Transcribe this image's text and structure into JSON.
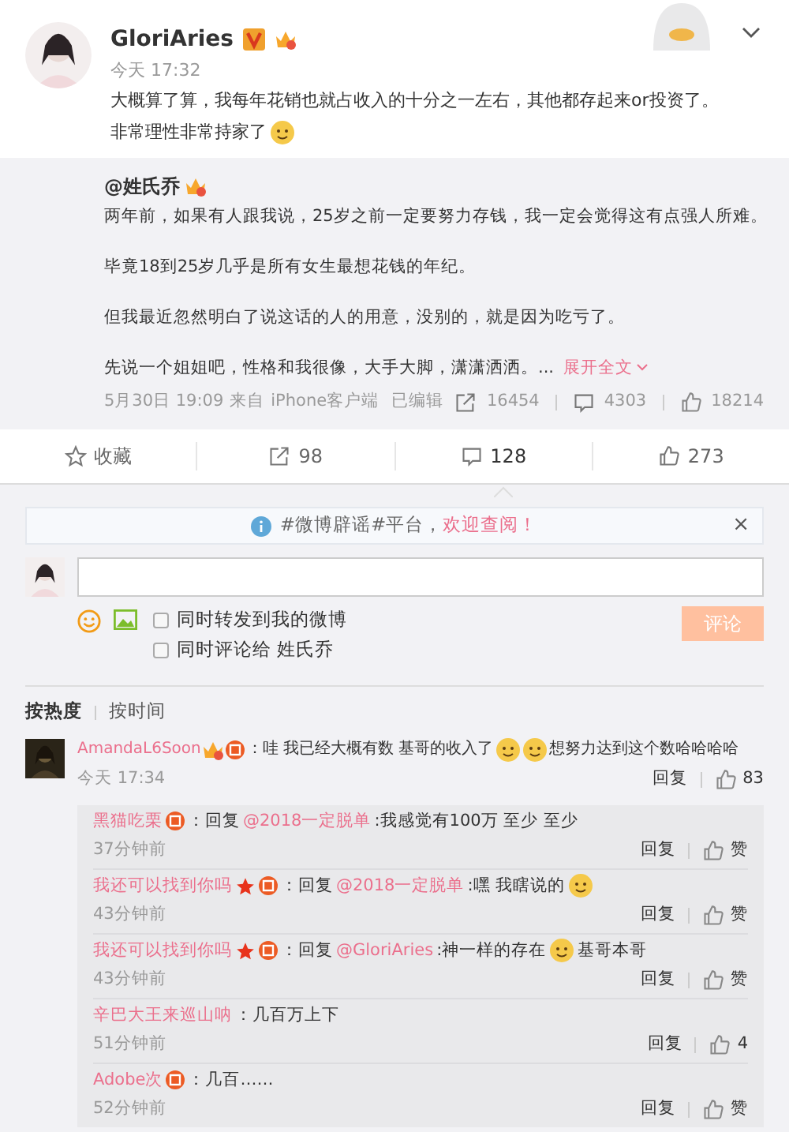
{
  "post": {
    "author": "GloriAries",
    "badges": [
      {
        "kind": "verified"
      },
      {
        "kind": "crown"
      }
    ],
    "time": "今天 17:32",
    "lines": [
      "大概算了算，我每年花销也就占收入的十分之一左右，其他都存起来or投资了。",
      "非常理性非常持家了"
    ]
  },
  "repost": {
    "author": "@姓氏乔",
    "paragraphs": [
      "两年前，如果有人跟我说，25岁之前一定要努力存钱，我一定会觉得这有点强人所难。",
      "毕竟18到25岁几乎是所有女生最想花钱的年纪。",
      "但我最近忽然明白了说这话的人的用意，没别的，就是因为吃亏了。",
      "先说一个姐姐吧，性格和我很像，大手大脚，潇潇洒洒。..."
    ],
    "expand": "展开全文",
    "date": "5月30日 19:09",
    "source_prefix": "来自",
    "source": "iPhone客户端",
    "edited": "已编辑",
    "reposts": "16454",
    "comments": "4303",
    "likes": "18214"
  },
  "actions": [
    {
      "kind": "favorite",
      "label": "收藏",
      "selected": false
    },
    {
      "kind": "repost",
      "label": "98",
      "selected": false
    },
    {
      "kind": "comment",
      "label": "128",
      "selected": true
    },
    {
      "kind": "like",
      "label": "273",
      "selected": false
    }
  ],
  "notice": {
    "text": "#微博辟谣#平台，",
    "link": "欢迎查阅！",
    "close": "×"
  },
  "composer": {
    "options": [
      {
        "label": "同时转发到我的微博",
        "checked": false
      },
      {
        "label": "同时评论给 姓氏乔",
        "checked": false
      }
    ],
    "submit": "评论",
    "disabled": true
  },
  "sort_tabs": [
    {
      "label": "按热度",
      "selected": true
    },
    {
      "label": "按时间",
      "selected": false
    }
  ],
  "comments": [
    {
      "user": "AmandaL6Soon",
      "badges": [
        {
          "kind": "crown"
        },
        {
          "kind": "red"
        }
      ],
      "segments": [
        {
          "kind": "text",
          "text": "：哇 我已经大概有数 基哥的收入了"
        },
        {
          "kind": "emoji"
        },
        {
          "kind": "emoji"
        },
        {
          "kind": "text",
          "text": "想努力达到这个数哈哈哈哈"
        }
      ],
      "time": "今天 17:34",
      "reply": "回复",
      "likes": "83",
      "replies": [
        {
          "user": "黑猫吃栗",
          "badges": [
            {
              "kind": "red"
            }
          ],
          "segments": [
            {
              "kind": "text",
              "text": "：回复"
            },
            {
              "kind": "mention",
              "text": "@2018一定脱单"
            },
            {
              "kind": "text",
              "text": ":我感觉有100万 至少 至少"
            }
          ],
          "time": "37分钟前",
          "reply": "回复",
          "likes": "赞"
        },
        {
          "user": "我还可以找到你吗",
          "badges": [
            {
              "kind": "star"
            },
            {
              "kind": "red"
            }
          ],
          "segments": [
            {
              "kind": "text",
              "text": "：回复"
            },
            {
              "kind": "mention",
              "text": "@2018一定脱单"
            },
            {
              "kind": "text",
              "text": ":嘿 我瞎说的"
            },
            {
              "kind": "emoji"
            }
          ],
          "time": "43分钟前",
          "reply": "回复",
          "likes": "赞"
        },
        {
          "user": "我还可以找到你吗",
          "badges": [
            {
              "kind": "star"
            },
            {
              "kind": "red"
            }
          ],
          "segments": [
            {
              "kind": "text",
              "text": "：回复"
            },
            {
              "kind": "mention",
              "text": "@GloriAries"
            },
            {
              "kind": "text",
              "text": ":神一样的存在"
            },
            {
              "kind": "emoji"
            },
            {
              "kind": "text",
              "text": "基哥本哥"
            }
          ],
          "time": "43分钟前",
          "reply": "回复",
          "likes": "赞"
        },
        {
          "user": "辛巴大王来巡山呐",
          "segments": [
            {
              "kind": "text",
              "text": "：几百万上下"
            }
          ],
          "time": "51分钟前",
          "reply": "回复",
          "likes": "4"
        },
        {
          "user": "Adobe次",
          "badges": [
            {
              "kind": "red"
            }
          ],
          "segments": [
            {
              "kind": "text",
              "text": "：几百……"
            }
          ],
          "time": "52分钟前",
          "reply": "回复",
          "likes": "赞"
        }
      ]
    }
  ]
}
